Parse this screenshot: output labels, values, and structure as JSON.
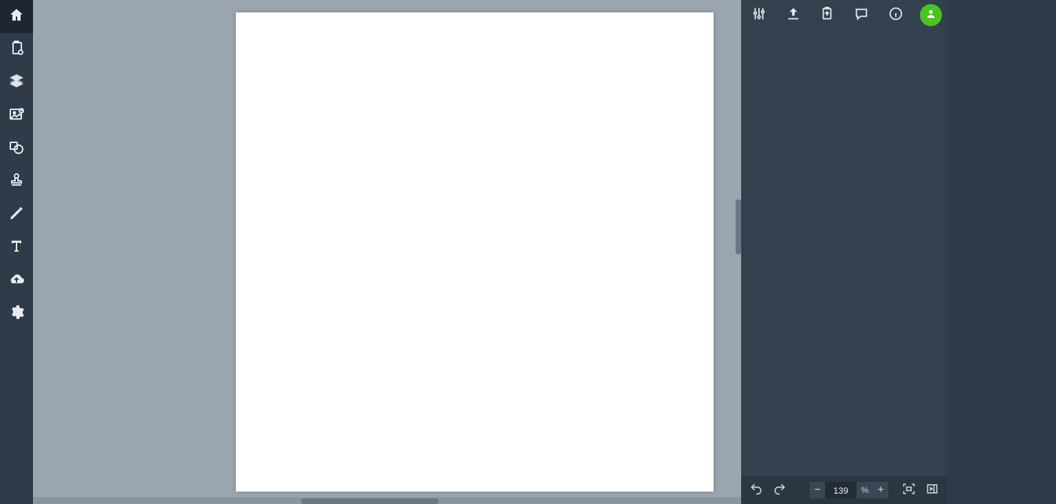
{
  "left_toolbar": {
    "items": [
      {
        "name": "home-icon",
        "active": true
      },
      {
        "name": "clipboard-icon",
        "active": false
      },
      {
        "name": "layers-icon",
        "active": false
      },
      {
        "name": "image-icon",
        "active": false
      },
      {
        "name": "shapes-icon",
        "active": false
      },
      {
        "name": "stamp-icon",
        "active": false
      },
      {
        "name": "pencil-icon",
        "active": false
      },
      {
        "name": "text-icon",
        "active": false
      },
      {
        "name": "cloud-upload-icon",
        "active": false
      },
      {
        "name": "gear-icon",
        "active": false
      }
    ]
  },
  "right_top": {
    "items": [
      {
        "name": "sliders-icon"
      },
      {
        "name": "upload-icon"
      },
      {
        "name": "export-clipboard-icon"
      },
      {
        "name": "comment-icon"
      },
      {
        "name": "info-icon"
      }
    ],
    "avatar_color": "#4bc421"
  },
  "right_bottom": {
    "undo_name": "undo-icon",
    "redo_name": "redo-icon",
    "zoom_minus": "−",
    "zoom_value": "139",
    "zoom_percent": "%",
    "zoom_plus": "+",
    "fit_name": "fit-screen-icon",
    "collapse_name": "panel-collapse-icon"
  }
}
